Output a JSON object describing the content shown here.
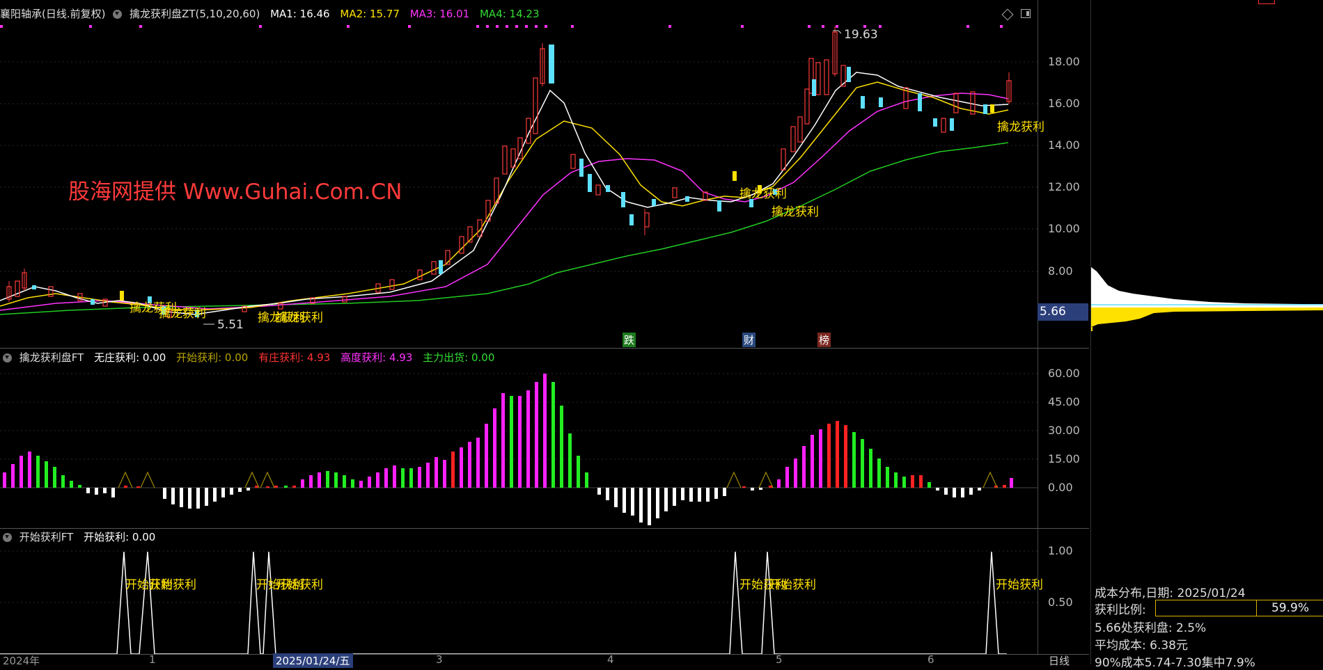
{
  "main": {
    "title": "襄阳轴承(日线.前复权)",
    "indicator": "擒龙获利盘ZT(5,10,20,60)",
    "ma": [
      {
        "label": "MA1: 16.46",
        "color": "#ffffff"
      },
      {
        "label": "MA2: 15.77",
        "color": "#ffe100"
      },
      {
        "label": "MA3: 16.01",
        "color": "#ff33ff"
      },
      {
        "label": "MA4: 14.23",
        "color": "#33dd33"
      }
    ],
    "yticks": [
      "18.00",
      "16.00",
      "14.00",
      "12.00",
      "10.00",
      "8.00"
    ],
    "high_label": "19.63",
    "low_label": "5.51",
    "current_price": "5.66",
    "watermark": "股海网提供 Www.Guhai.Com.CN",
    "signal_label": "擒龙获利",
    "tags": [
      {
        "text": "跌",
        "color": "#2ab52a"
      },
      {
        "text": "财",
        "color": "#3a6fd8"
      },
      {
        "text": "榜",
        "color": "#c0392b"
      }
    ]
  },
  "sub1": {
    "title": "擒龙获利盘FT",
    "values": [
      {
        "label": "无庄获利: 0.00",
        "color": "#ffffff"
      },
      {
        "label": "开始获利: 0.00",
        "color": "#b8a400"
      },
      {
        "label": "有庄获利: 4.93",
        "color": "#ff3333"
      },
      {
        "label": "高度获利: 4.93",
        "color": "#ff33ff"
      },
      {
        "label": "主力出货: 0.00",
        "color": "#33dd33"
      }
    ],
    "yticks": [
      "60.00",
      "45.00",
      "30.00",
      "15.00",
      "0.00"
    ]
  },
  "sub2": {
    "title": "开始获利FT",
    "value": "开始获利: 0.00",
    "yticks": [
      "1.00",
      "0.50"
    ],
    "signal_label": "开始获利"
  },
  "xaxis": {
    "labels": [
      "2024年",
      "1",
      "2025/01/24/五",
      "3",
      "4",
      "5",
      "6"
    ],
    "period": "日线"
  },
  "cost": {
    "date": "成本分布,日期: 2025/01/24",
    "ratio_label": "获利比例:",
    "ratio_value": "59.9%",
    "ratio_fraction": 0.599,
    "profit_at": "5.66处获利盘: 2.5%",
    "avg_cost": "平均成本: 6.38元",
    "range90": "90%成本5.74-7.30集中7.9%"
  }
}
